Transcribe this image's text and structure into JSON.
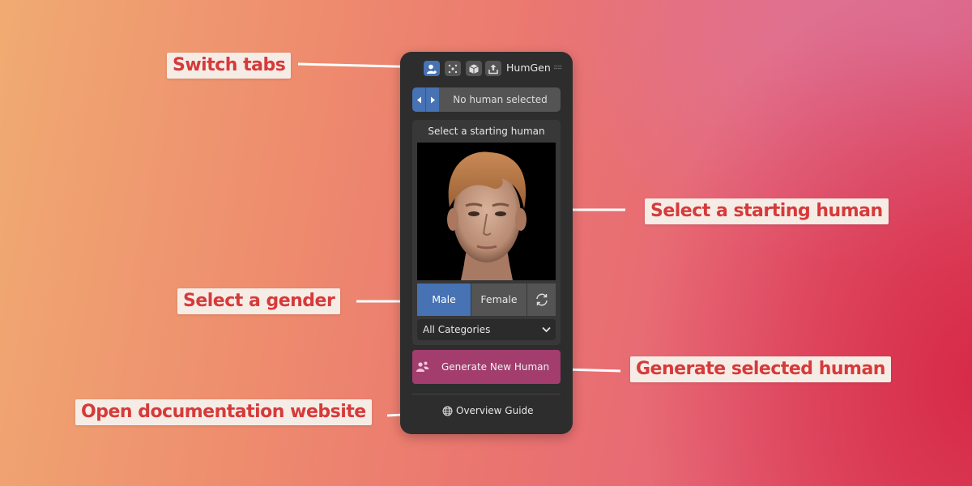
{
  "panel": {
    "title": "HumGen",
    "tabs": [
      {
        "name": "create-human-icon",
        "active": true
      },
      {
        "name": "sparkle-icon",
        "active": false
      },
      {
        "name": "box-icon",
        "active": false
      },
      {
        "name": "export-icon",
        "active": false
      }
    ],
    "selector_label": "No human selected",
    "section_title": "Select a starting human",
    "gender": {
      "male": "Male",
      "female": "Female",
      "selected": "Male"
    },
    "category": "All Categories",
    "generate_label": "Generate New Human",
    "guide_label": "Overview Guide"
  },
  "callouts": {
    "switch_tabs": "Switch tabs",
    "select_starting": "Select a starting human",
    "select_gender": "Select a gender",
    "generate": "Generate selected human",
    "docs": "Open documentation website"
  },
  "colors": {
    "accent_blue": "#4772b3",
    "generate_purple": "#a23d6d",
    "callout_text": "#d63a3a",
    "callout_bg": "#f6ece6"
  }
}
